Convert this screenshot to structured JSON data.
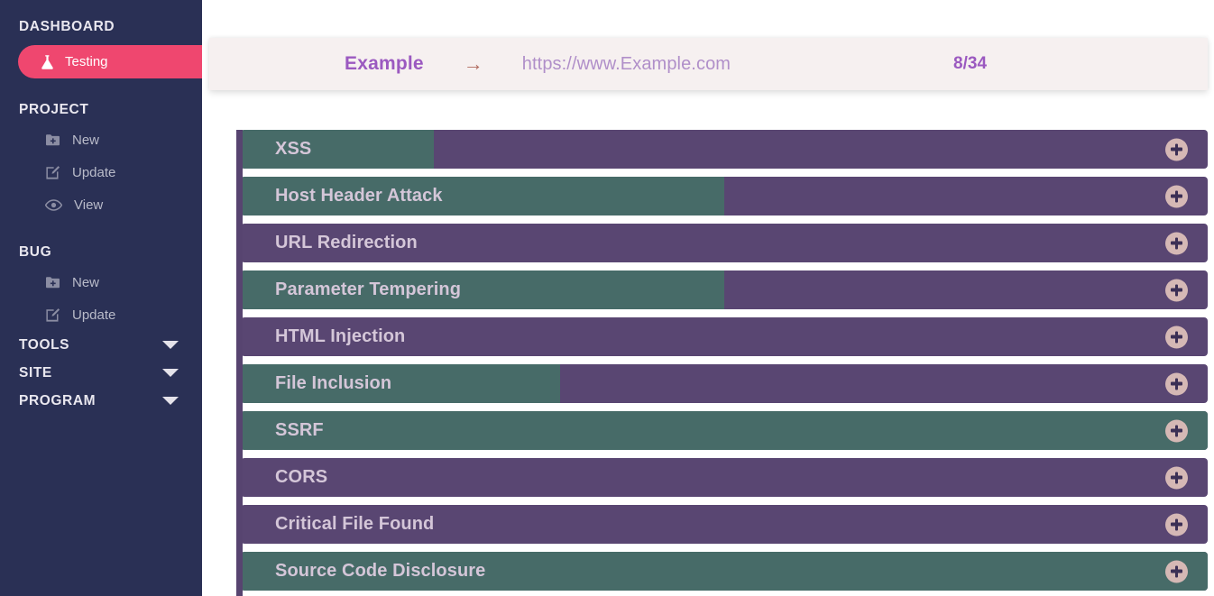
{
  "sidebar": {
    "sections": [
      {
        "title": "DASHBOARD"
      },
      {
        "title": "PROJECT"
      },
      {
        "title": "BUG"
      },
      {
        "title": "TOOLS"
      },
      {
        "title": "SITE"
      },
      {
        "title": "PROGRAM"
      }
    ],
    "active_item": {
      "label": "Testing",
      "icon": "flask-icon",
      "color": "#ef476f"
    },
    "project_items": [
      {
        "label": "New",
        "icon": "folder-plus-icon"
      },
      {
        "label": "Update",
        "icon": "pencil-square-icon"
      },
      {
        "label": "View",
        "icon": "eye-icon"
      }
    ],
    "bug_items": [
      {
        "label": "New",
        "icon": "folder-plus-icon"
      },
      {
        "label": "Update",
        "icon": "pencil-square-icon"
      }
    ],
    "collapsible": [
      {
        "label": "TOOLS",
        "icon": "chevron-down-icon"
      },
      {
        "label": "SITE",
        "icon": "chevron-down-icon"
      },
      {
        "label": "PROGRAM",
        "icon": "chevron-down-icon"
      }
    ],
    "background_color": "#2a3055"
  },
  "header": {
    "project_name": "Example",
    "arrow": "→",
    "url": "https://www.Example.com",
    "counter": "8/34",
    "name_color": "#9b59c0",
    "url_color": "#b08fc9",
    "background_color": "#f6f0f0"
  },
  "scan_list": {
    "track_color": "#574470",
    "bar_background_color": "#594672",
    "bar_fill_color": "#476b68",
    "label_color": "#d4c6d8",
    "plus_circle_color": "#d5b8b5",
    "add_icon": "plus-icon",
    "rows": [
      {
        "label": "XSS",
        "progress_pct": 20,
        "add_label": "+"
      },
      {
        "label": "Host Header Attack",
        "progress_pct": 50,
        "add_label": "+"
      },
      {
        "label": "URL Redirection",
        "progress_pct": 0,
        "add_label": "+"
      },
      {
        "label": "Parameter Tempering",
        "progress_pct": 50,
        "add_label": "+"
      },
      {
        "label": "HTML Injection",
        "progress_pct": 0,
        "add_label": "+"
      },
      {
        "label": "File Inclusion",
        "progress_pct": 33,
        "add_label": "+"
      },
      {
        "label": "SSRF",
        "progress_pct": 100,
        "add_label": "+"
      },
      {
        "label": "CORS",
        "progress_pct": 0,
        "add_label": "+"
      },
      {
        "label": "Critical File Found",
        "progress_pct": 0,
        "add_label": "+"
      },
      {
        "label": "Source Code Disclosure",
        "progress_pct": 100,
        "add_label": "+"
      }
    ]
  }
}
